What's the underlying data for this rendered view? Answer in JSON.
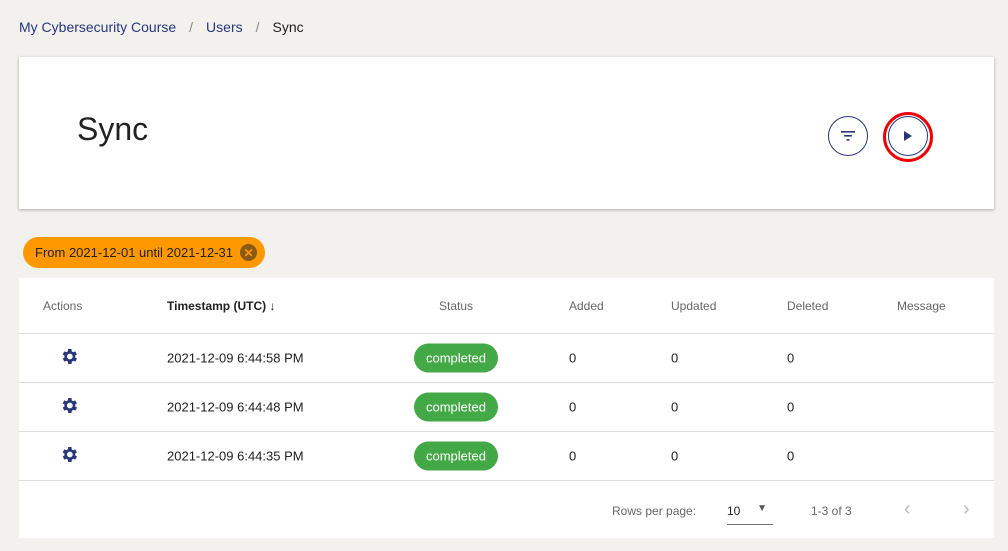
{
  "breadcrumb": [
    "My Cybersecurity Course",
    "Users",
    "Sync"
  ],
  "page_title": "Sync",
  "filter_chip": "From 2021-12-01 until 2021-12-31",
  "columns": {
    "actions": "Actions",
    "timestamp": "Timestamp (UTC)",
    "status": "Status",
    "added": "Added",
    "updated": "Updated",
    "deleted": "Deleted",
    "message": "Message"
  },
  "rows": [
    {
      "timestamp": "2021-12-09 6:44:58 PM",
      "status": "completed",
      "added": "0",
      "updated": "0",
      "deleted": "0",
      "message": ""
    },
    {
      "timestamp": "2021-12-09 6:44:48 PM",
      "status": "completed",
      "added": "0",
      "updated": "0",
      "deleted": "0",
      "message": ""
    },
    {
      "timestamp": "2021-12-09 6:44:35 PM",
      "status": "completed",
      "added": "0",
      "updated": "0",
      "deleted": "0",
      "message": ""
    }
  ],
  "pagination": {
    "rows_per_page_label": "Rows per page:",
    "rows_per_page": "10",
    "range": "1-3 of 3"
  }
}
